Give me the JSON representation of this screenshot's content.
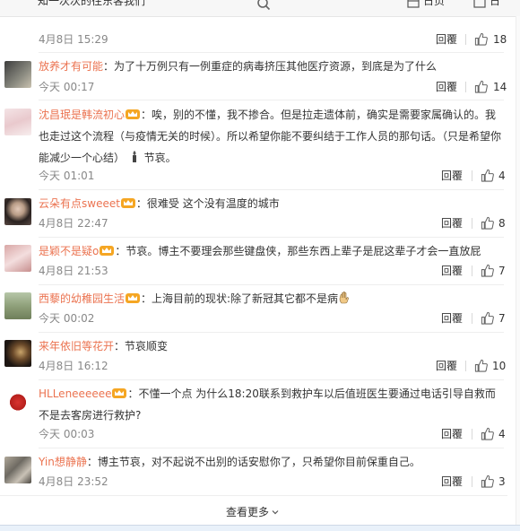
{
  "topbar": {
    "clipped_text": "知一次次的往东客我们",
    "right_label_1": "日页",
    "right_label_2": "日",
    "search_icon": "search-icon"
  },
  "comments": [
    {
      "user": "",
      "text": "知一次次的往东客我们",
      "time": "4月8日 15:29",
      "reply": "回覆",
      "likes": "18",
      "crown": false
    },
    {
      "user": "放养才有可能",
      "text": "：为了十万例只有一例重症的病毒挤压其他医疗资源，到底是为了什么",
      "time": "今天 00:17",
      "reply": "回覆",
      "likes": "14",
      "crown": false
    },
    {
      "user": "沈昌珉是韩流初心",
      "text": "：唉，别的不懂，我不掺合。但是拉走遗体前，确实是需要家属确认的。我也走过这个流程（与疫情无关的时候）。所以希望你能不要纠结于工作人员的那句话。（只是希望你能减少一个心结）",
      "text_suffix": "节哀。",
      "time": "今天 01:01",
      "reply": "回覆",
      "likes": "4",
      "crown": true
    },
    {
      "user": "云朵有点sweeet",
      "text": "：很难受 这个没有温度的城市",
      "time": "4月8日 22:47",
      "reply": "回覆",
      "likes": "8",
      "crown": true
    },
    {
      "user": "是颖不是疑o",
      "text": "：节哀。博主不要理会那些键盘侠，那些东西上辈子是屁这辈子才会一直放屁",
      "time": "4月8日 21:53",
      "reply": "回覆",
      "likes": "7",
      "crown": true
    },
    {
      "user": "西藜的幼稚园生活",
      "text": "：上海目前的现状:除了新冠其它都不是病",
      "time": "今天 00:02",
      "reply": "回覆",
      "likes": "7",
      "crown": true
    },
    {
      "user": "来年依旧等花开",
      "text": "：节哀顺变",
      "time": "4月8日 16:12",
      "reply": "回覆",
      "likes": "10",
      "crown": false
    },
    {
      "user": "HLLeneeeeee",
      "text": "：不懂一个点 为什么18:20联系到救护车以后值班医生要通过电话引导自救而不是去客房进行救护?",
      "time": "今天 00:03",
      "reply": "回覆",
      "likes": "4",
      "crown": true
    },
    {
      "user": "Yin想静静",
      "text": "：博主节哀，对不起说不出别的话安慰你了，只希望你目前保重自己。",
      "time": "4月8日 23:52",
      "reply": "回覆",
      "likes": "3",
      "crown": false
    }
  ],
  "more": {
    "label": "查看更多"
  },
  "colors": {
    "username": "#eb7350",
    "meta": "#888888",
    "divider": "#eeeeee",
    "crown": "#f5a623"
  },
  "icons": {
    "like": "thumbs-up-icon",
    "crown": "crown-badge-icon",
    "more": "chevron-down-icon",
    "candle": "candle-icon",
    "hand": "hand-icon"
  }
}
